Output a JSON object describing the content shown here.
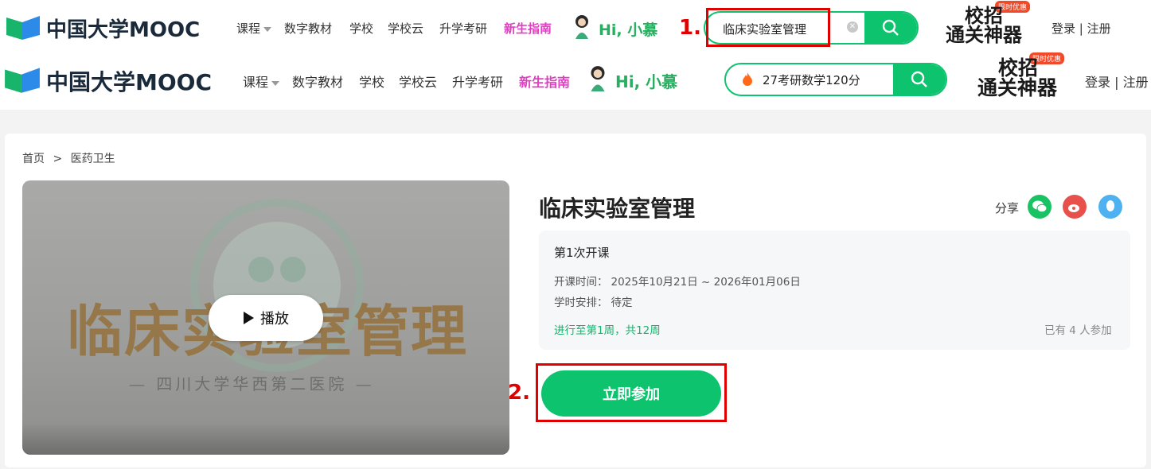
{
  "brand": {
    "name": "中国大学MOOC"
  },
  "nav": {
    "items": [
      "课程",
      "数字教材",
      "学校",
      "学校云",
      "升学考研"
    ],
    "highlight": "新生指南",
    "greeting": "Hi, 小慕"
  },
  "search_top": {
    "value": "临床实验室管理"
  },
  "search_main": {
    "value": "27考研数学120分"
  },
  "promo": {
    "badge": "限时优惠",
    "line1": "校招",
    "line2": "通关神器"
  },
  "auth": {
    "text": "登录 | 注册",
    "text2": "登录 | 注册"
  },
  "breadcrumb": {
    "home": "首页",
    "sep": ">",
    "category": "医药卫生"
  },
  "video": {
    "play_label": "播放",
    "title_big": "临床实验室管理",
    "hospital": "— 四川大学华西第二医院 —"
  },
  "course": {
    "title": "临床实验室管理",
    "share_label": "分享",
    "term": "第1次开课",
    "time_label": "开课时间：",
    "time_value": "2025年10月21日 ~ 2026年01月06日",
    "hours_label": "学时安排：",
    "hours_value": "待定",
    "progress": "进行至第1周，共12周",
    "participants": "已有 4 人参加",
    "join_label": "立即参加"
  },
  "annotations": {
    "step1": "1.",
    "step2": "2."
  },
  "colors": {
    "accent": "#0dc36e",
    "highlight": "#e040c0",
    "annotation": "#e00000"
  }
}
